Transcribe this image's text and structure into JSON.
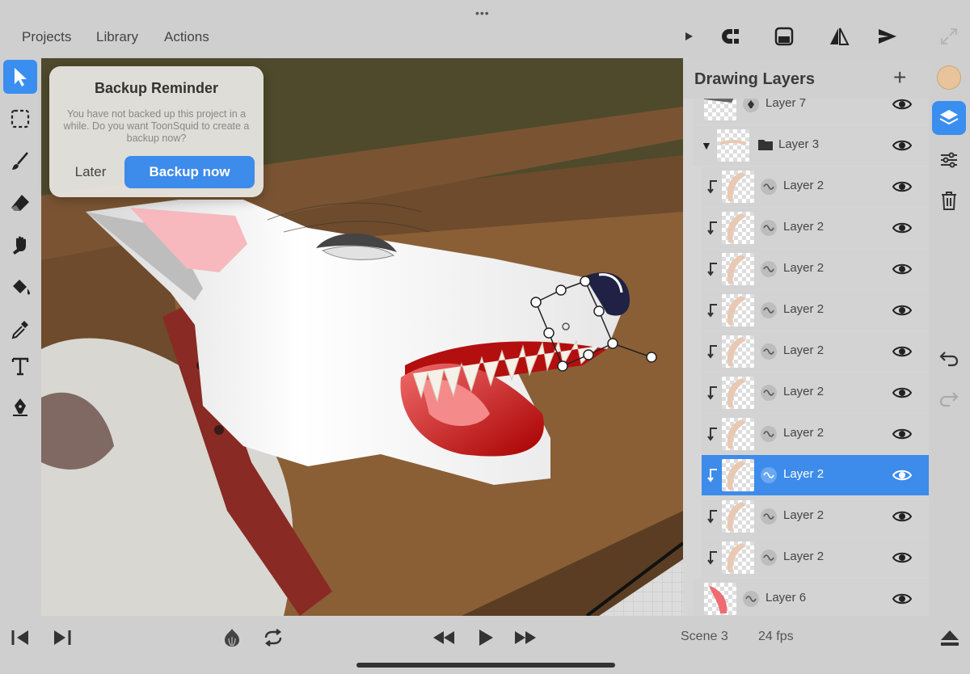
{
  "menu": {
    "projects": "Projects",
    "library": "Library",
    "actions": "Actions"
  },
  "top_toolbar": {
    "icons": [
      "play-icon",
      "magnet-icon",
      "frame-icon",
      "flip-icon",
      "send-icon",
      "fullscreen-icon"
    ]
  },
  "left_tools": [
    "select-arrow-icon",
    "marquee-icon",
    "brush-icon",
    "eraser-icon",
    "smudge-icon",
    "fill-bucket-icon",
    "eyedropper-icon",
    "text-icon",
    "pen-tool-icon"
  ],
  "popup": {
    "title": "Backup Reminder",
    "message": "You have not backed up this project in a while. Do you want ToonSquid to create a backup now?",
    "later_label": "Later",
    "backup_label": "Backup now"
  },
  "layers_panel": {
    "title": "Drawing Layers",
    "rows": [
      {
        "name": "Layer 7",
        "type": "pen"
      },
      {
        "name": "Layer 3",
        "type": "folder"
      },
      {
        "name": "Layer 2",
        "type": "clipped"
      },
      {
        "name": "Layer 2",
        "type": "clipped"
      },
      {
        "name": "Layer 2",
        "type": "clipped"
      },
      {
        "name": "Layer 2",
        "type": "clipped"
      },
      {
        "name": "Layer 2",
        "type": "clipped"
      },
      {
        "name": "Layer 2",
        "type": "clipped"
      },
      {
        "name": "Layer 2",
        "type": "clipped"
      },
      {
        "name": "Layer 2",
        "type": "clipped",
        "selected": true
      },
      {
        "name": "Layer 2",
        "type": "clipped"
      },
      {
        "name": "Layer 2",
        "type": "clipped"
      },
      {
        "name": "Layer 6",
        "type": "normal"
      }
    ]
  },
  "right_tools": {
    "color_swatch": "#e9c49a",
    "icons": [
      "layers-icon",
      "adjustments-icon",
      "trash-icon",
      "undo-icon",
      "redo-icon"
    ]
  },
  "bottom_bar": {
    "scene_label": "Scene 3",
    "fps_label": "24 fps"
  },
  "colors": {
    "accent": "#3d8bea"
  }
}
